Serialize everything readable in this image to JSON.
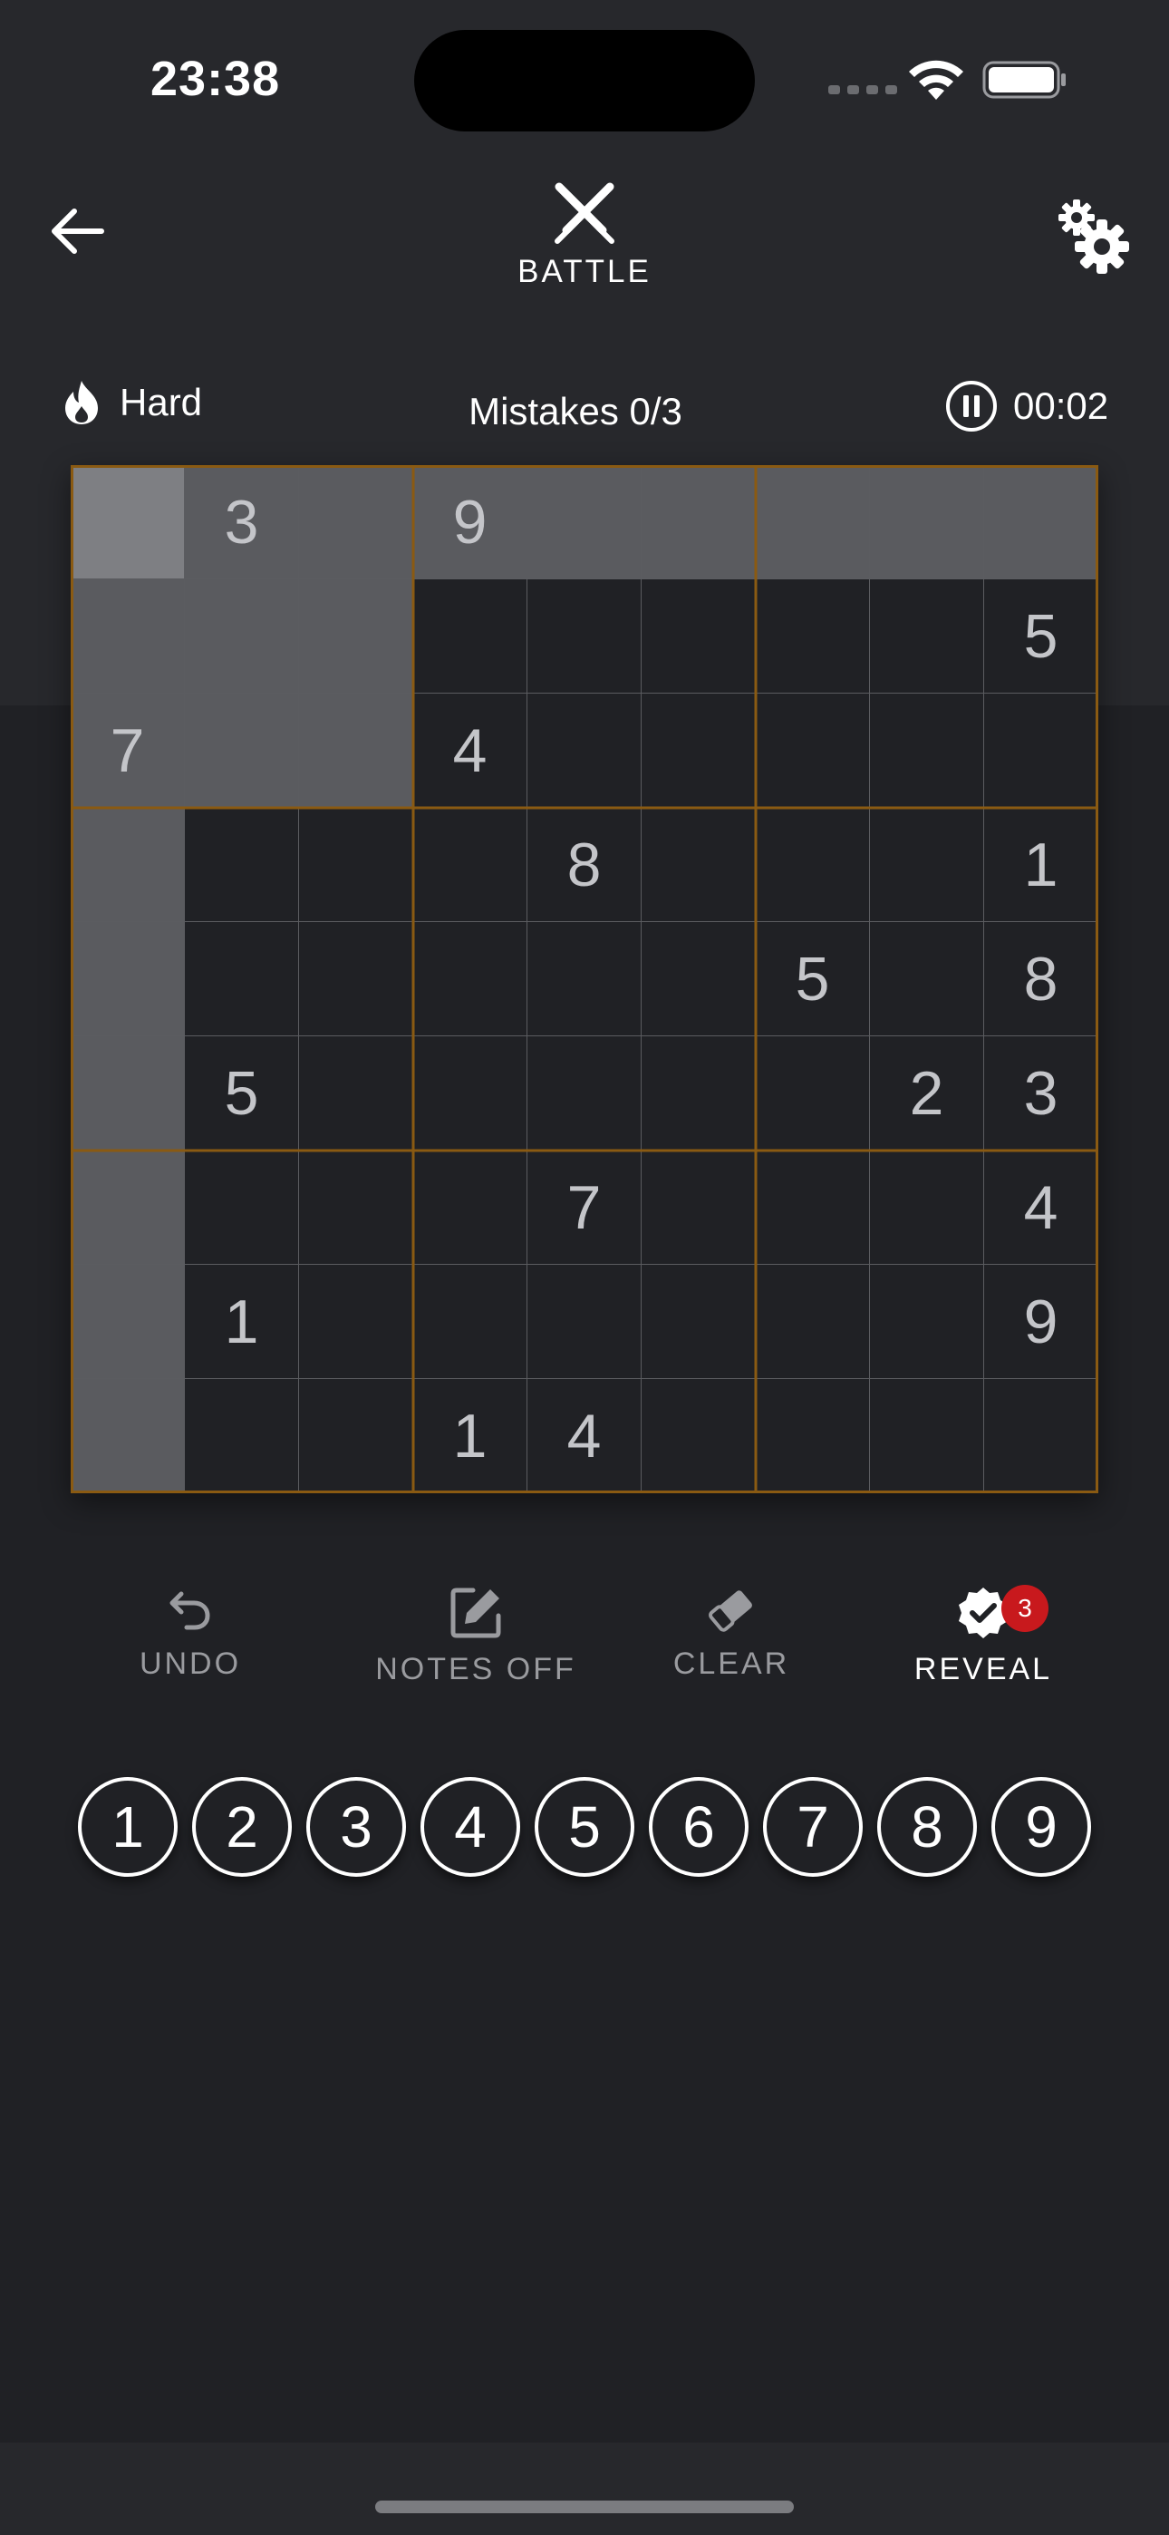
{
  "status_bar": {
    "time": "23:38"
  },
  "header": {
    "mode_label": "BATTLE",
    "mode_icon": "crossed-swords-icon",
    "back_icon": "arrow-left-icon",
    "settings_icon": "gears-icon"
  },
  "info": {
    "difficulty": "Hard",
    "difficulty_icon": "flame-icon",
    "mistakes": "Mistakes 0/3",
    "timer": "00:02",
    "timer_icon": "pause-circle-icon"
  },
  "board": {
    "rows": [
      [
        "",
        "3",
        "",
        "9",
        "",
        "",
        "",
        "",
        ""
      ],
      [
        "",
        "",
        "",
        "",
        "",
        "",
        "",
        "",
        "5"
      ],
      [
        "7",
        "",
        "",
        "4",
        "",
        "",
        "",
        "",
        ""
      ],
      [
        "",
        "",
        "",
        "",
        "8",
        "",
        "",
        "",
        "1"
      ],
      [
        "",
        "",
        "",
        "",
        "",
        "",
        "5",
        "",
        "8"
      ],
      [
        "",
        "5",
        "",
        "",
        "",
        "",
        "",
        "2",
        "3"
      ],
      [
        "",
        "",
        "",
        "",
        "7",
        "",
        "",
        "",
        "4"
      ],
      [
        "",
        "1",
        "",
        "",
        "",
        "",
        "",
        "",
        "9"
      ],
      [
        "",
        "",
        "",
        "1",
        "4",
        "",
        "",
        "",
        ""
      ]
    ],
    "selected": {
      "row": 0,
      "col": 0
    },
    "colors": {
      "box_line": "#8a5a12",
      "cell_line": "#5b5c60",
      "highlight": "#5a5b5f",
      "selected": "#7e7f83"
    }
  },
  "tools": {
    "undo": {
      "label": "UNDO",
      "icon": "undo-icon"
    },
    "notes": {
      "label": "NOTES OFF",
      "icon": "edit-icon"
    },
    "clear": {
      "label": "CLEAR",
      "icon": "eraser-icon"
    },
    "reveal": {
      "label": "REVEAL",
      "icon": "verified-badge-icon",
      "badge": "3"
    }
  },
  "numpad": [
    "1",
    "2",
    "3",
    "4",
    "5",
    "6",
    "7",
    "8",
    "9"
  ]
}
